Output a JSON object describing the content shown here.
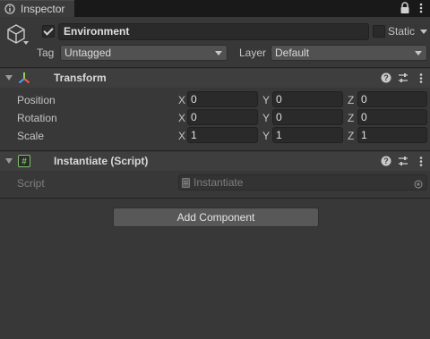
{
  "tab": {
    "icon": "info-icon",
    "label": "Inspector"
  },
  "header": {
    "active_checked": true,
    "name": "Environment",
    "static_label": "Static",
    "static_checked": false,
    "tag_label": "Tag",
    "tag_value": "Untagged",
    "layer_label": "Layer",
    "layer_value": "Default"
  },
  "transform": {
    "title": "Transform",
    "rows": [
      {
        "label": "Position",
        "x": "0",
        "y": "0",
        "z": "0"
      },
      {
        "label": "Rotation",
        "x": "0",
        "y": "0",
        "z": "0"
      },
      {
        "label": "Scale",
        "x": "1",
        "y": "1",
        "z": "1"
      }
    ],
    "axes": {
      "x": "X",
      "y": "Y",
      "z": "Z"
    }
  },
  "script_component": {
    "title": "Instantiate (Script)",
    "script_label": "Script",
    "script_value": "Instantiate"
  },
  "add_component_label": "Add Component",
  "colors": {
    "background": "#383838",
    "tabbar": "#191919",
    "field": "#2a2a2a",
    "dropdown": "#515151",
    "button": "#585858"
  }
}
